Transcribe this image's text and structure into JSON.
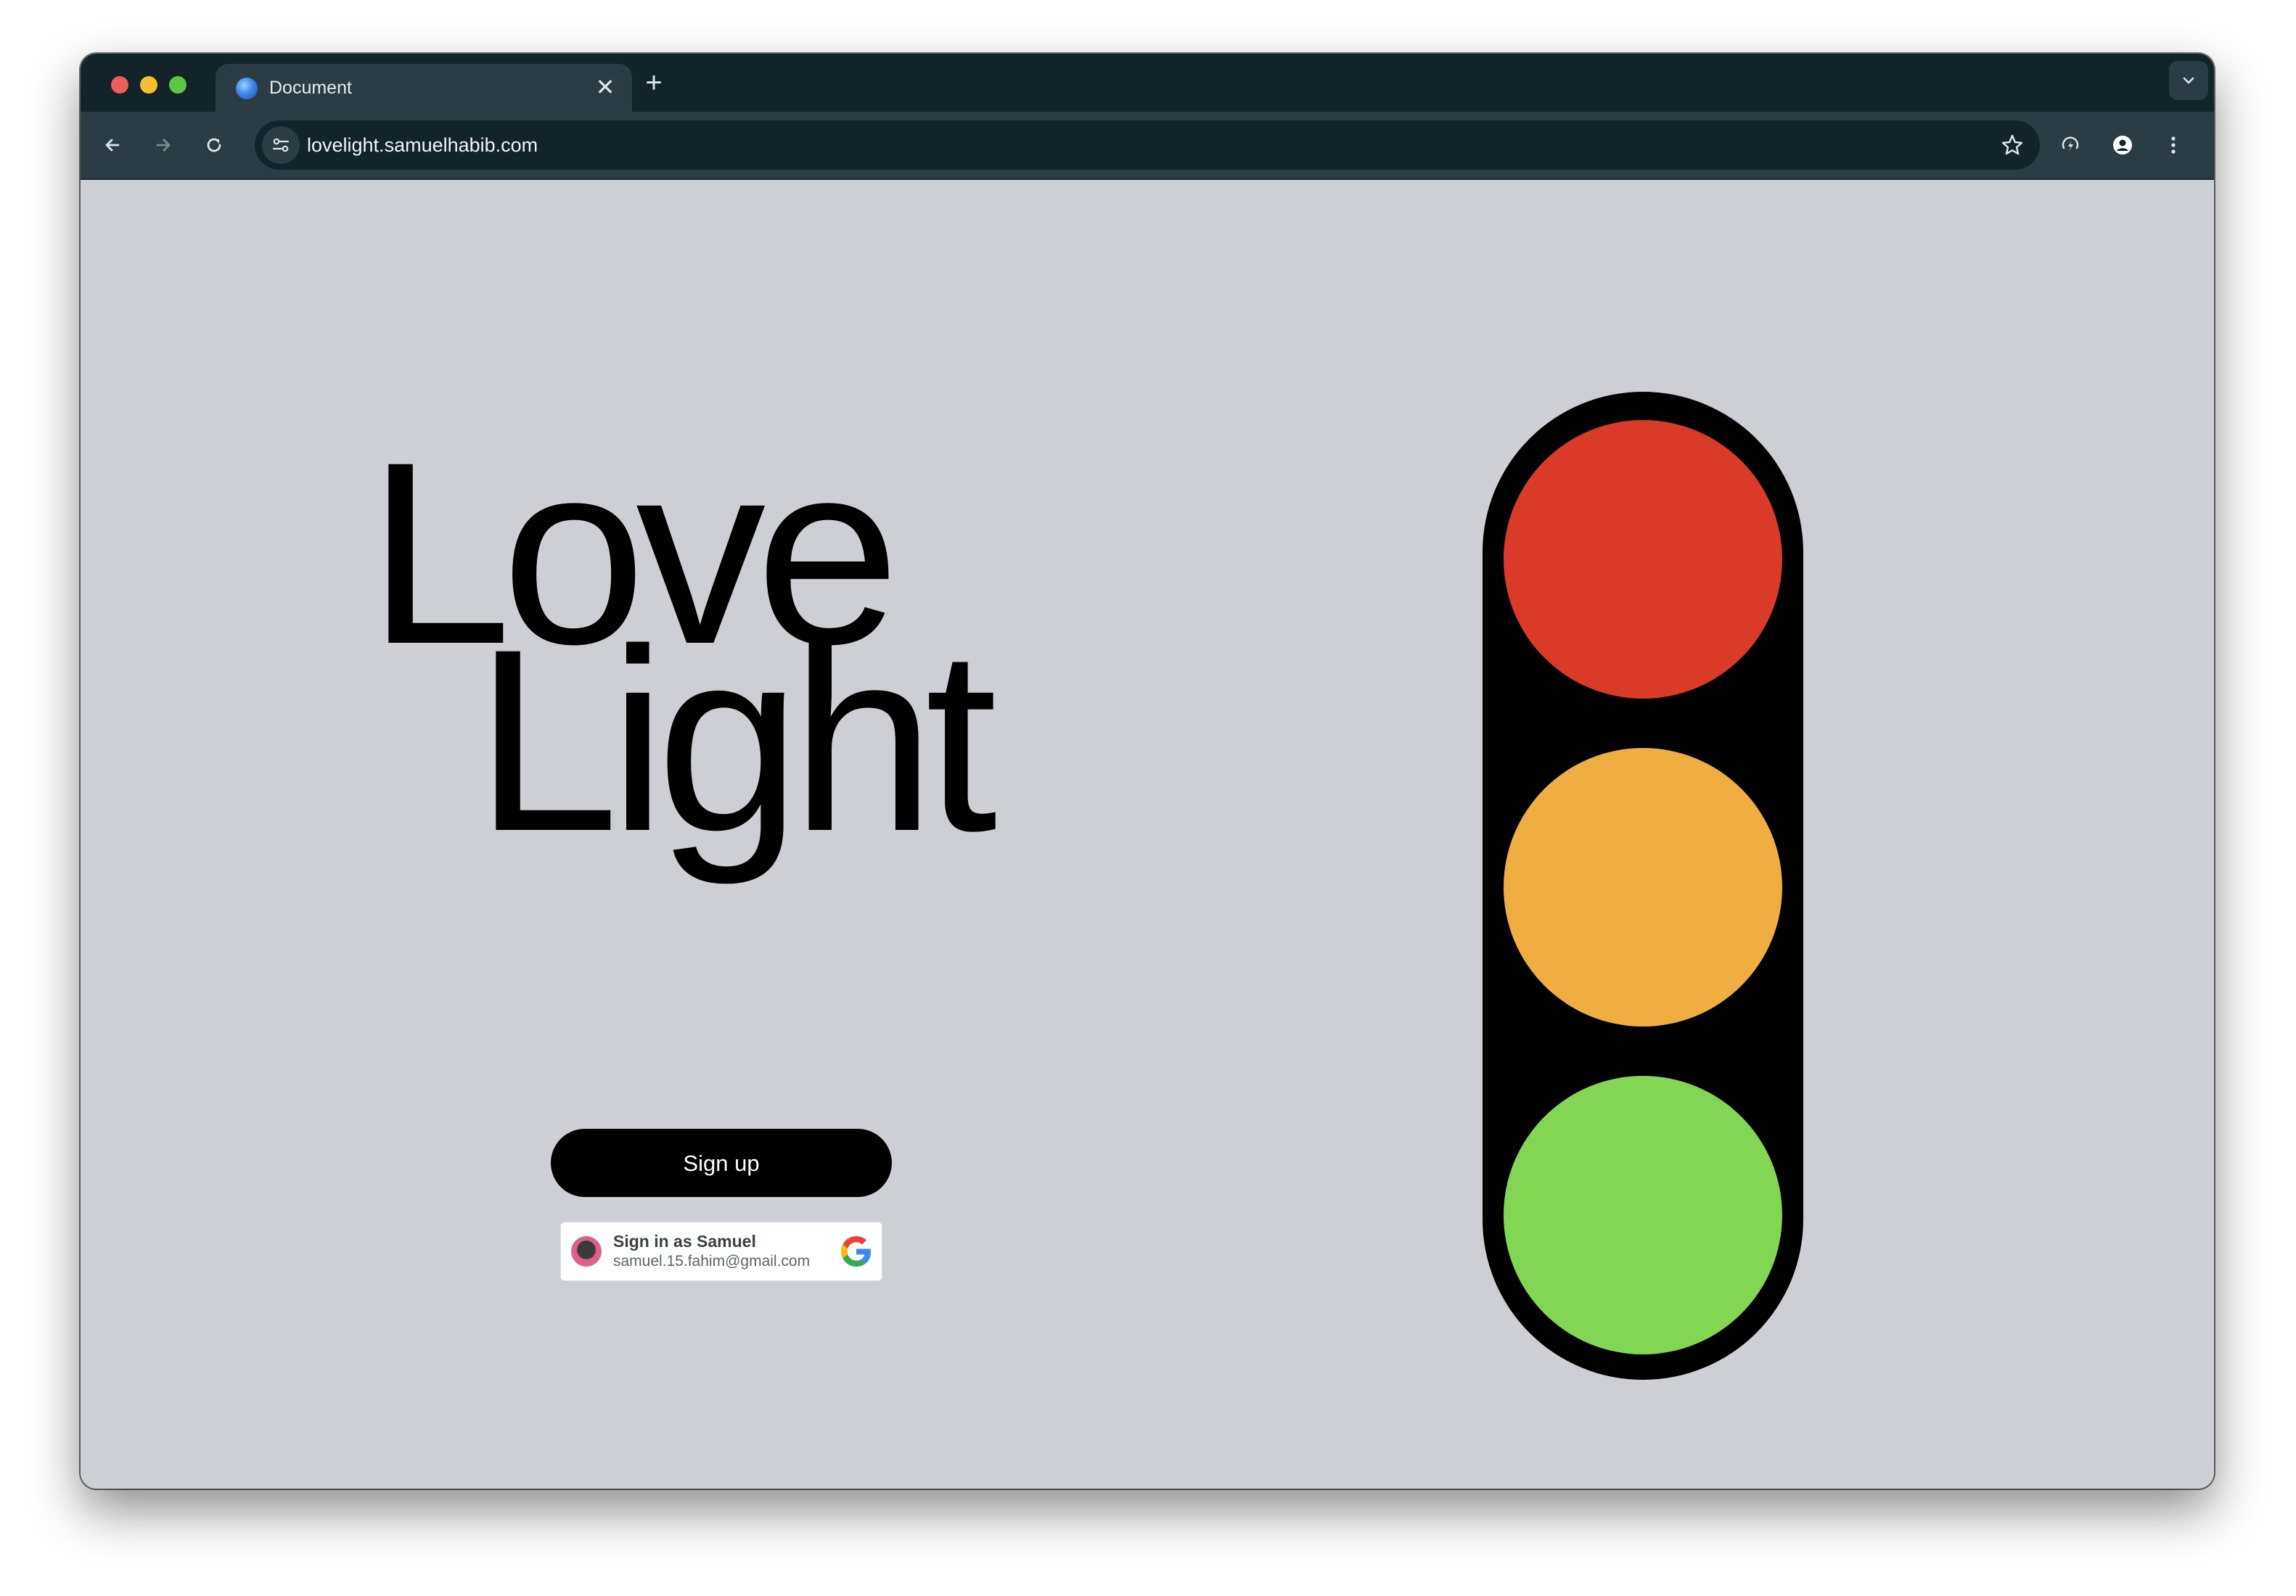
{
  "browser": {
    "tab_title": "Document",
    "tab_close_glyph": "✕",
    "new_tab_glyph": "+",
    "url": "lovelight.samuelhabib.com"
  },
  "page": {
    "brand_line1": "Love",
    "brand_line2": "Light",
    "signup_label": "Sign up",
    "google_signin": {
      "title": "Sign in as Samuel",
      "email": "samuel.15.fahim@gmail.com"
    },
    "traffic_light_colors": {
      "red": "#d93b28",
      "amber": "#f0ae42",
      "green": "#82d653",
      "housing": "#000000"
    }
  },
  "colors": {
    "page_background": "#cecfd4",
    "tabstrip": "#12232a",
    "toolbar": "#2b3c45"
  }
}
